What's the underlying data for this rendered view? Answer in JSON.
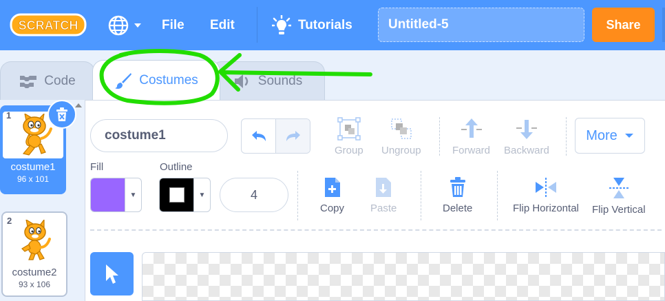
{
  "menubar": {
    "logo_text": "SCRATCH",
    "file_label": "File",
    "edit_label": "Edit",
    "tutorials_label": "Tutorials",
    "project_title": "Untitled-5",
    "share_label": "Share",
    "colors": {
      "bar": "#4c97ff",
      "share": "#ff8c1a"
    }
  },
  "tabs": [
    {
      "label": "Code",
      "icon": "code-blocks-icon"
    },
    {
      "label": "Costumes",
      "icon": "brush-icon",
      "active": true
    },
    {
      "label": "Sounds",
      "icon": "speaker-icon"
    }
  ],
  "costumes": [
    {
      "number": "1",
      "name": "costume1",
      "size": "96 x 101",
      "selected": true
    },
    {
      "number": "2",
      "name": "costume2",
      "size": "93 x 106",
      "selected": false
    }
  ],
  "editor": {
    "costume_name": "costume1",
    "group_label": "Group",
    "ungroup_label": "Ungroup",
    "forward_label": "Forward",
    "backward_label": "Backward",
    "more_label": "More",
    "fill_label": "Fill",
    "outline_label": "Outline",
    "fill_color": "#9966ff",
    "outline_color": "#000000",
    "stroke_width": "4",
    "copy_label": "Copy",
    "paste_label": "Paste",
    "delete_label": "Delete",
    "flip_h_label": "Flip Horizontal",
    "flip_v_label": "Flip Vertical"
  },
  "annotation": {
    "color": "#22dd00"
  }
}
